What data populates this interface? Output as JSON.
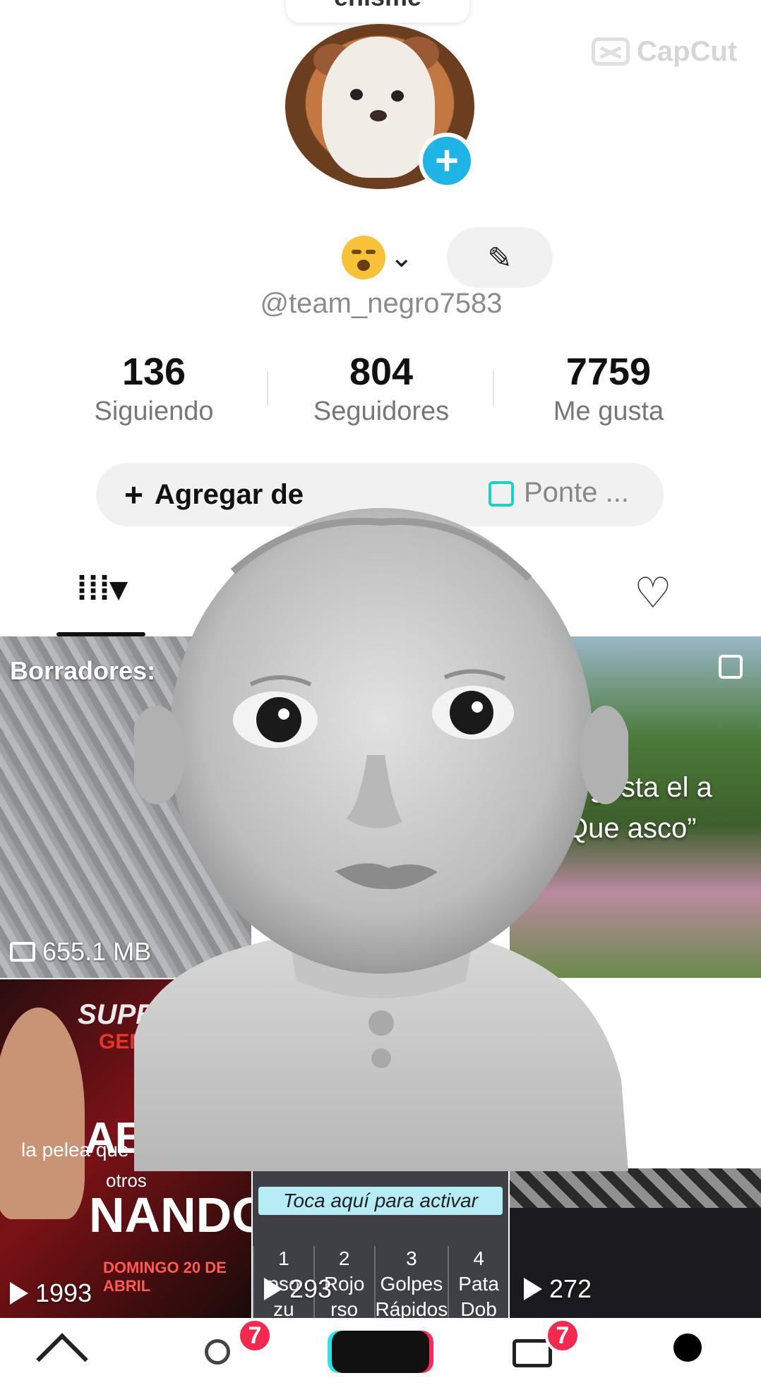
{
  "header": {
    "top_chip_label": "enisme",
    "watermark": "CapCut",
    "username": "@team_negro7583",
    "avatar_add_symbol": "+",
    "dropdown_symbol": "⌄",
    "edit_symbol": "✎"
  },
  "stats": [
    {
      "number": "136",
      "label": "Siguiendo"
    },
    {
      "number": "804",
      "label": "Seguidores"
    },
    {
      "number": "7759",
      "label": "Me gusta"
    }
  ],
  "pill": {
    "add_symbol": "+",
    "add_label": "Agregar de",
    "ponte_label": "Ponte ..."
  },
  "tabs": {
    "grid_symbol": "⁞⁞⁞▾",
    "heart_symbol": "♡"
  },
  "grid": {
    "drafts": {
      "title": "Borradores:",
      "size": "655.1 MB"
    },
    "post2": {
      "line1": "e gusta el a",
      "line2": "Que asco”"
    },
    "post4": {
      "brand": "SUPERNOVA",
      "brand2": "GENESIS",
      "fighter": "ABRAH",
      "subtitle": "la pelea que",
      "otros": "otros",
      "name": "NANDO",
      "date": "DOMINGO 20 DE ABRIL",
      "views": "1993"
    },
    "post5": {
      "banner": "Toca aquí para activar",
      "columns": [
        {
          "num": "1",
          "lines": "pso\nzu"
        },
        {
          "num": "2",
          "lines": "Rojo\nrso"
        },
        {
          "num": "3",
          "lines": "Golpes\nRápidos"
        },
        {
          "num": "4",
          "lines": "Pata\nDob"
        }
      ],
      "views": "293"
    },
    "post6": {
      "views": "272"
    }
  },
  "nav": {
    "friends_badge": "7",
    "inbox_badge": "7",
    "create_symbol": "+"
  },
  "colors": {
    "accent_blue": "#1fb4e6",
    "badge_red": "#f5294f",
    "teal": "#1ad1c4"
  }
}
